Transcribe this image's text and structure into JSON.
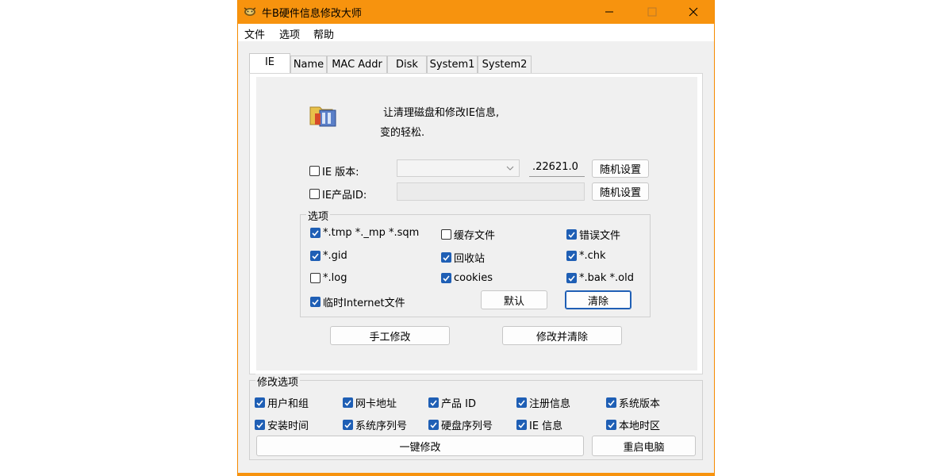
{
  "window": {
    "title": "牛B硬件信息修改大师",
    "icon": "cow-icon",
    "controls": [
      "minimize-icon",
      "maximize-icon",
      "close-icon"
    ]
  },
  "menu": [
    "文件",
    "选项",
    "帮助"
  ],
  "tabs": [
    "IE",
    "Name",
    "MAC Addr",
    "Disk",
    "System1",
    "System2"
  ],
  "active_tab": "IE",
  "ie_panel": {
    "description_line1": "让清理磁盘和修改IE信息,",
    "description_line2": "变的轻松.",
    "ie_version": {
      "label": "IE 版本:",
      "checked": false,
      "combo_value": "",
      "value": ".22621.0",
      "random_button": "随机设置"
    },
    "ie_product_id": {
      "label": "IE产品ID:",
      "checked": false,
      "value": "",
      "random_button": "随机设置"
    },
    "options_group": {
      "label": "选项",
      "items": [
        {
          "label": "*.tmp  *._mp  *.sqm",
          "checked": true
        },
        {
          "label": "缓存文件",
          "checked": false
        },
        {
          "label": "错误文件",
          "checked": true
        },
        {
          "label": "*.gid",
          "checked": true
        },
        {
          "label": "回收站",
          "checked": true
        },
        {
          "label": "*.chk",
          "checked": true
        },
        {
          "label": "*.log",
          "checked": false
        },
        {
          "label": "cookies",
          "checked": true
        },
        {
          "label": "*.bak  *.old",
          "checked": true
        },
        {
          "label": "临时Internet文件",
          "checked": true
        }
      ],
      "default_button": "默认",
      "clear_button": "清除"
    },
    "manual_modify_button": "手工修改",
    "modify_and_clear_button": "修改并清除"
  },
  "modify_options": {
    "label": "修改选项",
    "items": [
      {
        "label": "用户和组",
        "checked": true
      },
      {
        "label": "网卡地址",
        "checked": true
      },
      {
        "label": "产品 ID",
        "checked": true
      },
      {
        "label": "注册信息",
        "checked": true
      },
      {
        "label": "系统版本",
        "checked": true
      },
      {
        "label": "安装时间",
        "checked": true
      },
      {
        "label": "系统序列号",
        "checked": true
      },
      {
        "label": "硬盘序列号",
        "checked": true
      },
      {
        "label": "IE 信息",
        "checked": true
      },
      {
        "label": "本地时区",
        "checked": true
      }
    ],
    "one_click_button": "一键修改",
    "restart_button": "重启电脑"
  },
  "colors": {
    "titlebar": "#f7930e",
    "accent": "#1f5fb5",
    "window_bg": "#f0f0f0"
  }
}
